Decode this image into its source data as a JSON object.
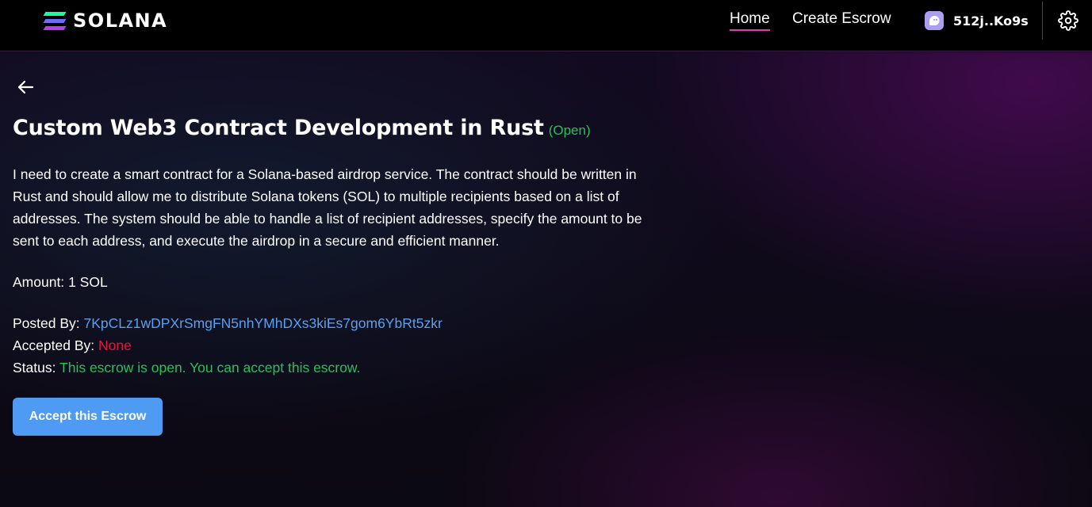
{
  "header": {
    "logo_text": "SOLANA",
    "nav": [
      {
        "label": "Home",
        "active": true
      },
      {
        "label": "Create Escrow",
        "active": false
      }
    ],
    "wallet_address": "512j..Ko9s",
    "icons": {
      "logo": "solana-logo-icon",
      "wallet": "phantom-wallet-icon",
      "settings": "gear-icon"
    }
  },
  "escrow": {
    "title": "Custom Web3 Contract Development in Rust",
    "status_tag": "(Open)",
    "description": "I need to create a smart contract for a Solana-based airdrop service. The contract should be written in Rust and should allow me to distribute Solana tokens (SOL) to multiple recipients based on a list of addresses. The system should be able to handle a list of recipient addresses, specify the amount to be sent to each address, and execute the airdrop in a secure and efficient manner.",
    "amount_label": "Amount:",
    "amount_value": "1 SOL",
    "posted_by_label": "Posted By:",
    "posted_by_value": "7KpCLz1wDPXrSmgFN5nhYMhDXs3kiEs7gom6YbRt5zkr",
    "accepted_by_label": "Accepted By:",
    "accepted_by_value": "None",
    "status_label": "Status:",
    "status_value": "This escrow is open. You can accept this escrow.",
    "accept_button_label": "Accept this Escrow"
  },
  "colors": {
    "accent_pink": "#e43bbd",
    "open_green": "#25c25a",
    "link_blue": "#5aa0f0",
    "none_red": "#e8153e",
    "button_blue": "#4f9af2"
  }
}
